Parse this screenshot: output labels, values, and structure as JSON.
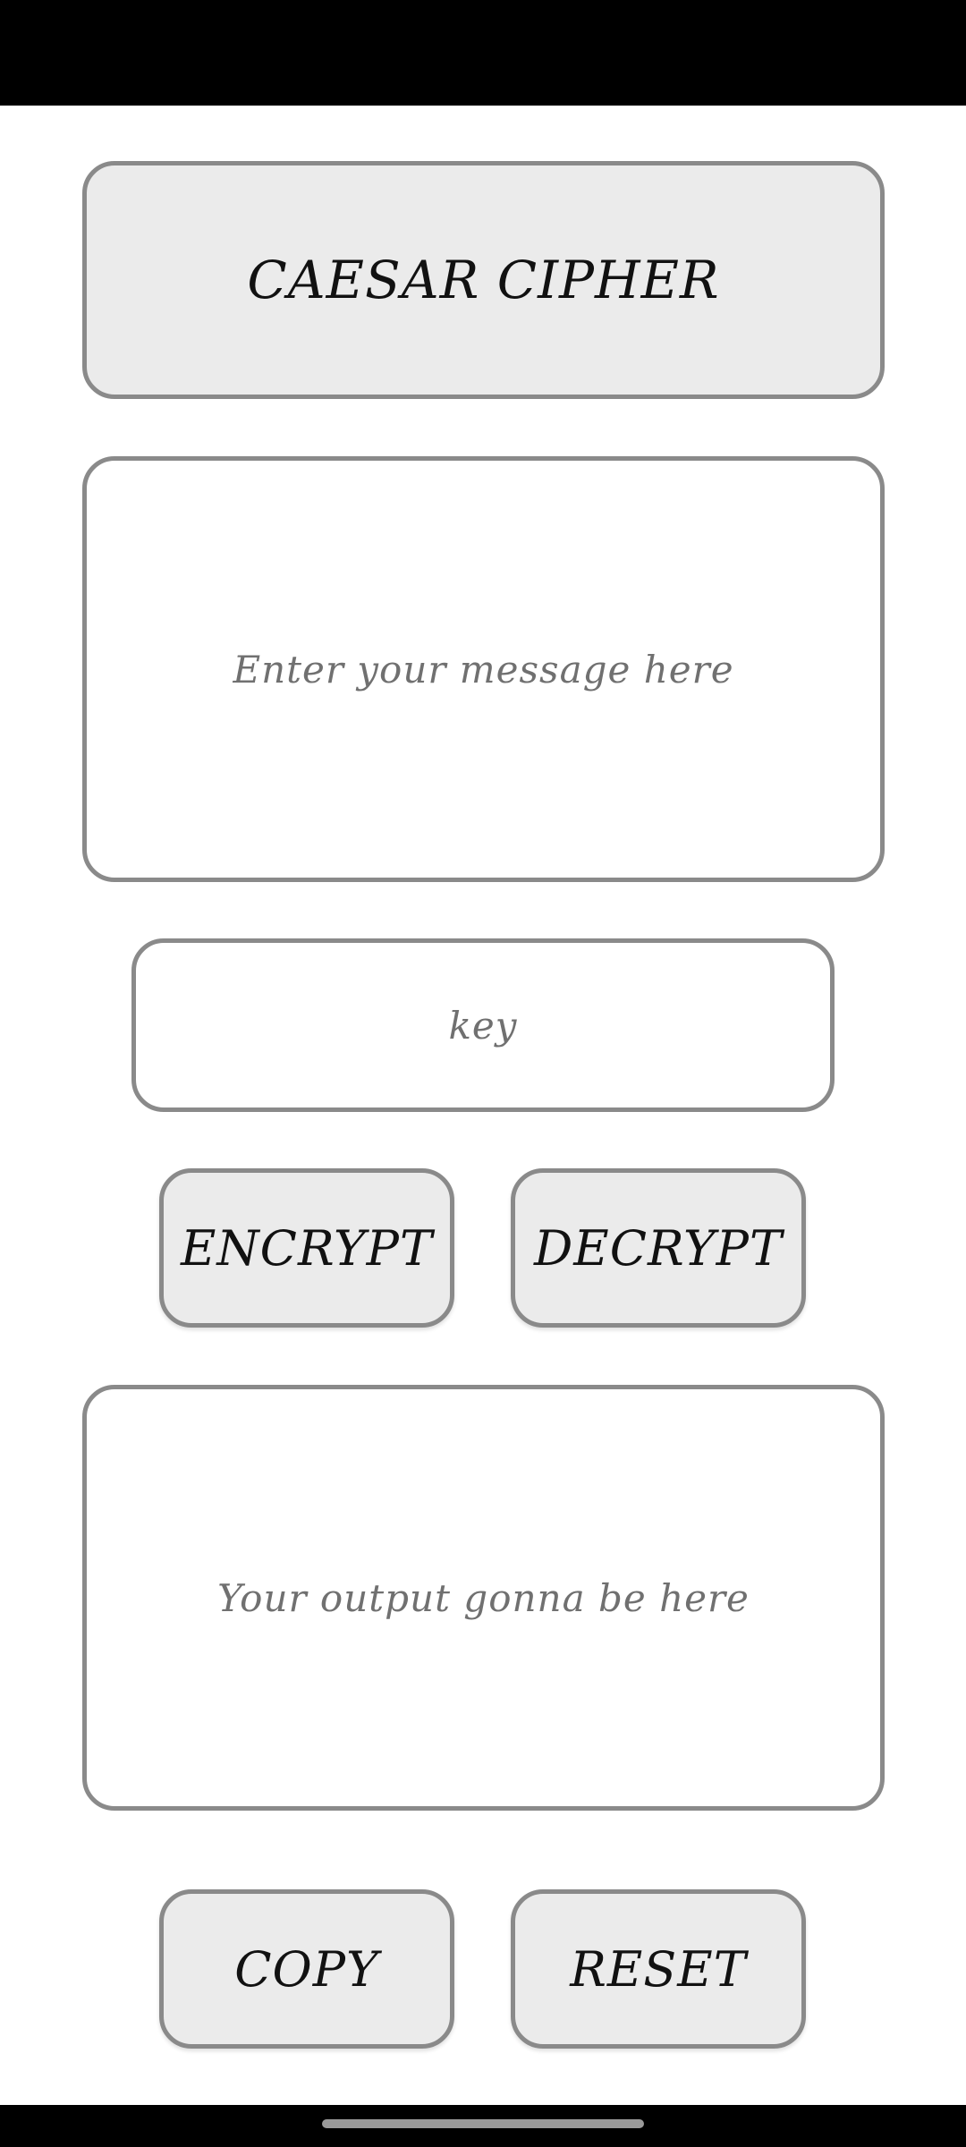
{
  "app": {
    "title": "CAESAR CIPHER"
  },
  "message_input": {
    "placeholder": "Enter your message here",
    "value": ""
  },
  "key_input": {
    "placeholder": "key",
    "value": ""
  },
  "actions": {
    "encrypt_label": "ENCRYPT",
    "decrypt_label": "DECRYPT",
    "copy_label": "COPY",
    "reset_label": "RESET"
  },
  "output": {
    "placeholder": "Your output gonna be here"
  },
  "colors": {
    "background": "#ffffff",
    "button_fill": "#ebebeb",
    "border": "#8a8a8a",
    "text": "#111111",
    "placeholder": "#707070",
    "system_bars": "#000000"
  }
}
